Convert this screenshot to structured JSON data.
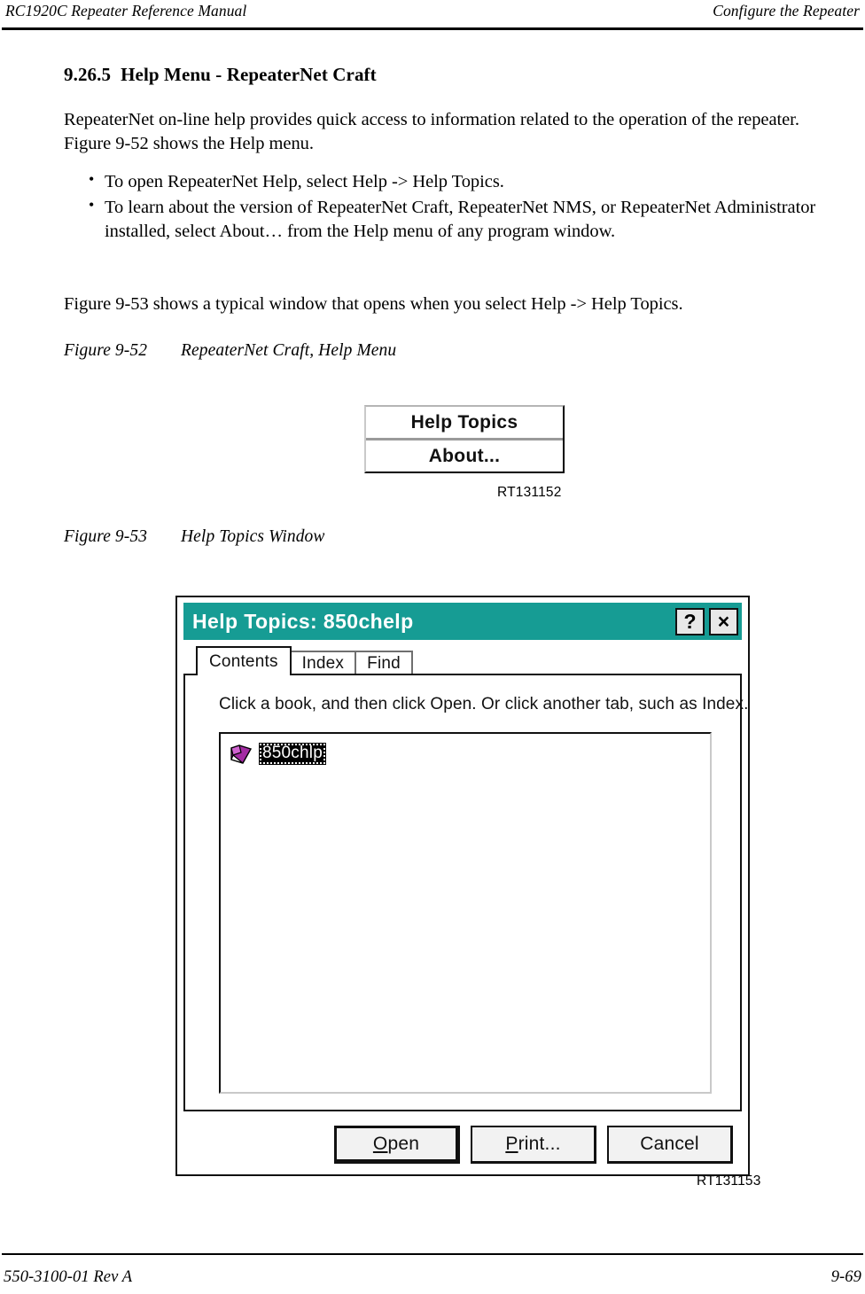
{
  "page": {
    "running_head_left": "RC1920C Repeater Reference Manual",
    "running_head_right": "Configure the Repeater",
    "footer_left": "550-3100-01 Rev A",
    "footer_right": "9-69"
  },
  "section": {
    "number": "9.26.5",
    "title": "Help Menu - RepeaterNet Craft"
  },
  "intro": {
    "paragraph": "RepeaterNet on-line help provides quick access to information related to the operation of the repeater. Figure 9-52 shows the Help menu."
  },
  "bullets": [
    "To open RepeaterNet Help, select Help -> Help Topics.",
    "To learn about the version of RepeaterNet Craft, RepeaterNet NMS, or RepeaterNet Administrator installed, select About… from the Help menu of any program window."
  ],
  "after_bullets": {
    "paragraph": "Figure 9-53 shows a typical window that opens when you select Help -> Help Topics."
  },
  "figure_52": {
    "caption_label": "Figure 9-52",
    "caption_text": "RepeaterNet Craft, Help Menu",
    "figure_id": "RT131152",
    "menu_items": [
      "Help Topics",
      "About..."
    ]
  },
  "figure_53": {
    "caption_label": "Figure 9-53",
    "caption_text": "Help Topics Window",
    "figure_id": "RT131153",
    "window": {
      "title": "Help Topics: 850chelp",
      "titlebar_color": "#169c94",
      "help_button_label": "?",
      "close_button_label": "×",
      "tabs": [
        {
          "label": "Contents",
          "active": true
        },
        {
          "label": "Index",
          "active": false
        },
        {
          "label": "Find",
          "active": false
        }
      ],
      "hint": "Click a book, and then click Open. Or click another tab, such as Index.",
      "tree_items": [
        {
          "label": "850chlp",
          "icon": "book-icon",
          "icon_color": "#a32ba3",
          "selected": true
        }
      ],
      "buttons": [
        {
          "label_prefix": "",
          "accel": "O",
          "label_suffix": "pen",
          "default": true
        },
        {
          "label_prefix": "",
          "accel": "P",
          "label_suffix": "rint...",
          "default": false
        },
        {
          "label_prefix": "Cancel",
          "accel": "",
          "label_suffix": "",
          "default": false
        }
      ]
    }
  }
}
